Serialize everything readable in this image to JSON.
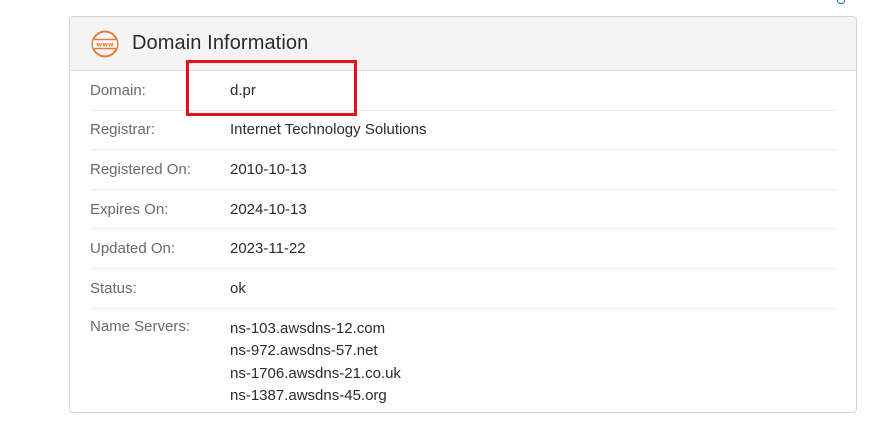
{
  "card": {
    "title": "Domain Information",
    "icon": "www-globe-icon",
    "icon_color": "#e8793a"
  },
  "rows": [
    {
      "label": "Domain:",
      "value": "d.pr"
    },
    {
      "label": "Registrar:",
      "value": "Internet Technology Solutions"
    },
    {
      "label": "Registered On:",
      "value": "2010-10-13"
    },
    {
      "label": "Expires On:",
      "value": "2024-10-13"
    },
    {
      "label": "Updated On:",
      "value": "2023-11-22"
    },
    {
      "label": "Status:",
      "value": "ok"
    }
  ],
  "name_servers": {
    "label": "Name Servers:",
    "values": [
      "ns-103.awsdns-12.com",
      "ns-972.awsdns-57.net",
      "ns-1706.awsdns-21.co.uk",
      "ns-1387.awsdns-45.org"
    ]
  },
  "highlight": {
    "color": "#e8101a"
  }
}
